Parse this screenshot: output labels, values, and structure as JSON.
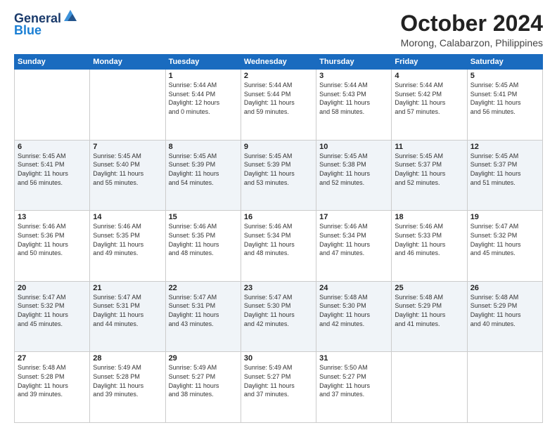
{
  "header": {
    "logo_general": "General",
    "logo_blue": "Blue",
    "month_title": "October 2024",
    "location": "Morong, Calabarzon, Philippines"
  },
  "calendar": {
    "headers": [
      "Sunday",
      "Monday",
      "Tuesday",
      "Wednesday",
      "Thursday",
      "Friday",
      "Saturday"
    ],
    "weeks": [
      [
        {
          "day": "",
          "info": ""
        },
        {
          "day": "",
          "info": ""
        },
        {
          "day": "1",
          "info": "Sunrise: 5:44 AM\nSunset: 5:44 PM\nDaylight: 12 hours\nand 0 minutes."
        },
        {
          "day": "2",
          "info": "Sunrise: 5:44 AM\nSunset: 5:44 PM\nDaylight: 11 hours\nand 59 minutes."
        },
        {
          "day": "3",
          "info": "Sunrise: 5:44 AM\nSunset: 5:43 PM\nDaylight: 11 hours\nand 58 minutes."
        },
        {
          "day": "4",
          "info": "Sunrise: 5:44 AM\nSunset: 5:42 PM\nDaylight: 11 hours\nand 57 minutes."
        },
        {
          "day": "5",
          "info": "Sunrise: 5:45 AM\nSunset: 5:41 PM\nDaylight: 11 hours\nand 56 minutes."
        }
      ],
      [
        {
          "day": "6",
          "info": "Sunrise: 5:45 AM\nSunset: 5:41 PM\nDaylight: 11 hours\nand 56 minutes."
        },
        {
          "day": "7",
          "info": "Sunrise: 5:45 AM\nSunset: 5:40 PM\nDaylight: 11 hours\nand 55 minutes."
        },
        {
          "day": "8",
          "info": "Sunrise: 5:45 AM\nSunset: 5:39 PM\nDaylight: 11 hours\nand 54 minutes."
        },
        {
          "day": "9",
          "info": "Sunrise: 5:45 AM\nSunset: 5:39 PM\nDaylight: 11 hours\nand 53 minutes."
        },
        {
          "day": "10",
          "info": "Sunrise: 5:45 AM\nSunset: 5:38 PM\nDaylight: 11 hours\nand 52 minutes."
        },
        {
          "day": "11",
          "info": "Sunrise: 5:45 AM\nSunset: 5:37 PM\nDaylight: 11 hours\nand 52 minutes."
        },
        {
          "day": "12",
          "info": "Sunrise: 5:45 AM\nSunset: 5:37 PM\nDaylight: 11 hours\nand 51 minutes."
        }
      ],
      [
        {
          "day": "13",
          "info": "Sunrise: 5:46 AM\nSunset: 5:36 PM\nDaylight: 11 hours\nand 50 minutes."
        },
        {
          "day": "14",
          "info": "Sunrise: 5:46 AM\nSunset: 5:35 PM\nDaylight: 11 hours\nand 49 minutes."
        },
        {
          "day": "15",
          "info": "Sunrise: 5:46 AM\nSunset: 5:35 PM\nDaylight: 11 hours\nand 48 minutes."
        },
        {
          "day": "16",
          "info": "Sunrise: 5:46 AM\nSunset: 5:34 PM\nDaylight: 11 hours\nand 48 minutes."
        },
        {
          "day": "17",
          "info": "Sunrise: 5:46 AM\nSunset: 5:34 PM\nDaylight: 11 hours\nand 47 minutes."
        },
        {
          "day": "18",
          "info": "Sunrise: 5:46 AM\nSunset: 5:33 PM\nDaylight: 11 hours\nand 46 minutes."
        },
        {
          "day": "19",
          "info": "Sunrise: 5:47 AM\nSunset: 5:32 PM\nDaylight: 11 hours\nand 45 minutes."
        }
      ],
      [
        {
          "day": "20",
          "info": "Sunrise: 5:47 AM\nSunset: 5:32 PM\nDaylight: 11 hours\nand 45 minutes."
        },
        {
          "day": "21",
          "info": "Sunrise: 5:47 AM\nSunset: 5:31 PM\nDaylight: 11 hours\nand 44 minutes."
        },
        {
          "day": "22",
          "info": "Sunrise: 5:47 AM\nSunset: 5:31 PM\nDaylight: 11 hours\nand 43 minutes."
        },
        {
          "day": "23",
          "info": "Sunrise: 5:47 AM\nSunset: 5:30 PM\nDaylight: 11 hours\nand 42 minutes."
        },
        {
          "day": "24",
          "info": "Sunrise: 5:48 AM\nSunset: 5:30 PM\nDaylight: 11 hours\nand 42 minutes."
        },
        {
          "day": "25",
          "info": "Sunrise: 5:48 AM\nSunset: 5:29 PM\nDaylight: 11 hours\nand 41 minutes."
        },
        {
          "day": "26",
          "info": "Sunrise: 5:48 AM\nSunset: 5:29 PM\nDaylight: 11 hours\nand 40 minutes."
        }
      ],
      [
        {
          "day": "27",
          "info": "Sunrise: 5:48 AM\nSunset: 5:28 PM\nDaylight: 11 hours\nand 39 minutes."
        },
        {
          "day": "28",
          "info": "Sunrise: 5:49 AM\nSunset: 5:28 PM\nDaylight: 11 hours\nand 39 minutes."
        },
        {
          "day": "29",
          "info": "Sunrise: 5:49 AM\nSunset: 5:27 PM\nDaylight: 11 hours\nand 38 minutes."
        },
        {
          "day": "30",
          "info": "Sunrise: 5:49 AM\nSunset: 5:27 PM\nDaylight: 11 hours\nand 37 minutes."
        },
        {
          "day": "31",
          "info": "Sunrise: 5:50 AM\nSunset: 5:27 PM\nDaylight: 11 hours\nand 37 minutes."
        },
        {
          "day": "",
          "info": ""
        },
        {
          "day": "",
          "info": ""
        }
      ]
    ]
  }
}
